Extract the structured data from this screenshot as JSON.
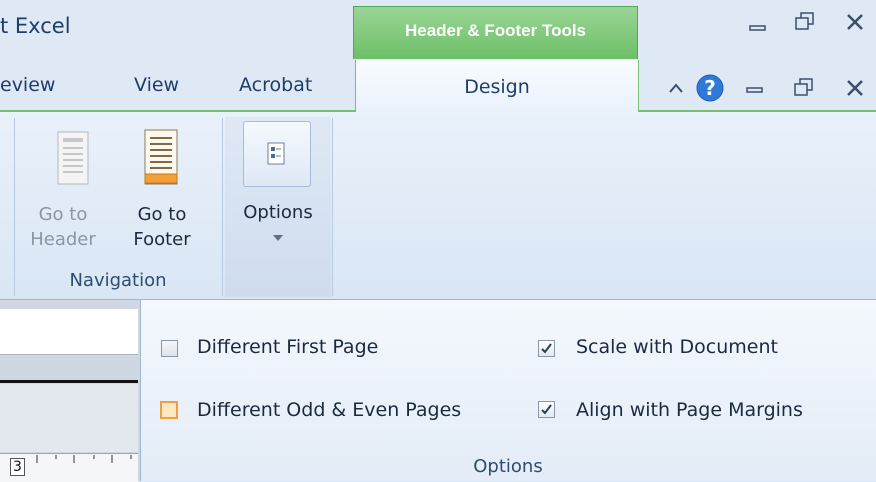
{
  "title_bar": {
    "app_title_fragment": "t Excel"
  },
  "contextual_tab_header": "Header & Footer Tools",
  "tabs": [
    {
      "label": "eview"
    },
    {
      "label": "View"
    },
    {
      "label": "Acrobat"
    },
    {
      "label": "Design",
      "active": true
    }
  ],
  "window_controls": {
    "app": [
      "minimize",
      "restore",
      "close"
    ],
    "document": [
      "collapse-ribbon",
      "help",
      "minimize",
      "restore",
      "close"
    ]
  },
  "ribbon": {
    "navigation_group": {
      "label": "Navigation",
      "buttons": [
        {
          "label_line1": "Go to",
          "label_line2": "Header",
          "enabled": false
        },
        {
          "label_line1": "Go to",
          "label_line2": "Footer",
          "enabled": true
        }
      ]
    },
    "options_button": {
      "label": "Options"
    }
  },
  "options_panel": {
    "label": "Options",
    "checkboxes": [
      {
        "label": "Different First Page",
        "checked": false
      },
      {
        "label": "Different Odd & Even Pages",
        "checked": false,
        "focused": true
      },
      {
        "label": "Scale with Document",
        "checked": true
      },
      {
        "label": "Align with Page Margins",
        "checked": true
      }
    ]
  },
  "ruler": {
    "marker": "3"
  },
  "colors": {
    "contextual_green": "#6dbf68",
    "focus_orange": "#f0a040",
    "text_blue": "#1f3d6a"
  }
}
